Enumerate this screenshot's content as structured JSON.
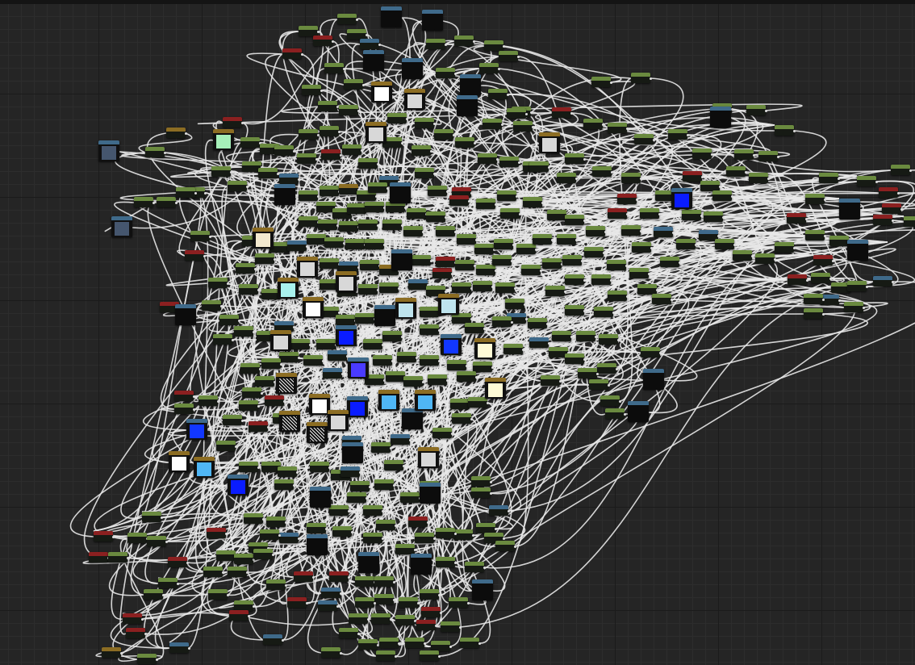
{
  "canvas": {
    "background": "#252525",
    "grid_minor": "#2d2d2d",
    "grid_major": "#1b1b1b",
    "wire_color": "#e8e8e8"
  },
  "node_categories": {
    "scalar": "#6a8a3f",
    "vector": "#3f6a8a",
    "function": "#8b2020",
    "texture": "#8c6d23"
  },
  "swatch_colors": {
    "mint": "#a6f0b9",
    "cream": "#f3e9cf",
    "white": "#ffffff",
    "light_gray": "#d8d8d8",
    "cyan": "#a9f2ee",
    "sky": "#bfe4ee",
    "blue": "#0a1cff",
    "deep_blue": "#1237ff",
    "violet": "#4a3bff",
    "light_blue": "#4fb6f5",
    "pale_yellow": "#fffbd6",
    "slate": "#45566e",
    "noise": "noise-texture",
    "cloud": "cloud-texture"
  }
}
